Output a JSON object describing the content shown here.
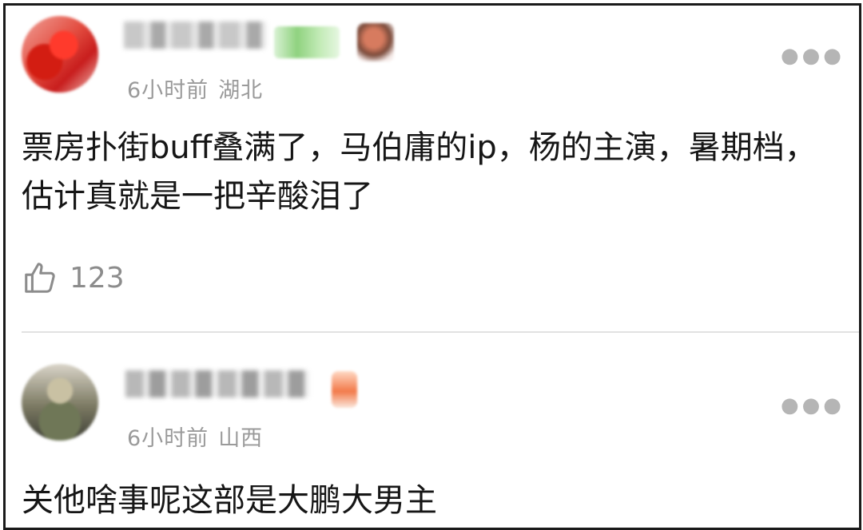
{
  "comments": [
    {
      "time": "6小时前",
      "location": "湖北",
      "text": "票房扑街buff叠满了，马伯庸的ip，杨的主演，暑期档，估计真就是一把辛酸泪了",
      "likes": "123",
      "more_icon": "more-dots-icon",
      "like_icon": "thumbs-up-icon"
    },
    {
      "time": "6小时前",
      "location": "山西",
      "text": "关他啥事呢这部是大鹏大男主",
      "more_icon": "more-dots-icon"
    }
  ],
  "colors": {
    "text": "#161616",
    "meta": "#9a9a9a",
    "border": "#1a1a1a",
    "divider": "#e2e2e2"
  }
}
